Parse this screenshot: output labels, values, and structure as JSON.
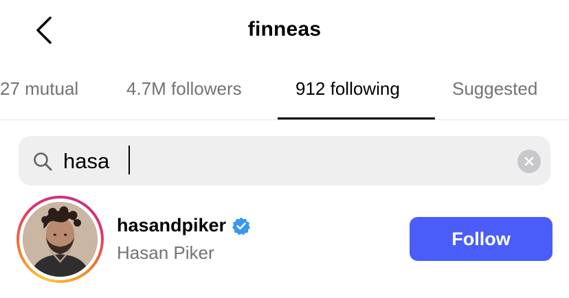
{
  "header": {
    "title": "finneas",
    "back_icon": "chevron-left-icon"
  },
  "tabs": [
    {
      "label": "27 mutual",
      "active": false
    },
    {
      "label": "4.7M followers",
      "active": false
    },
    {
      "label": "912 following",
      "active": true
    },
    {
      "label": "Suggested",
      "active": false
    }
  ],
  "search": {
    "value": "hasa",
    "icon": "search-icon",
    "clear_icon": "clear-icon"
  },
  "results": [
    {
      "username": "hasandpiker",
      "full_name": "Hasan Piker",
      "verified": true,
      "follow_label": "Follow"
    }
  ],
  "colors": {
    "follow_button": "#4a5df9",
    "verified_badge": "#3897f0",
    "secondary_text": "#737373",
    "search_background": "#efeff0"
  }
}
